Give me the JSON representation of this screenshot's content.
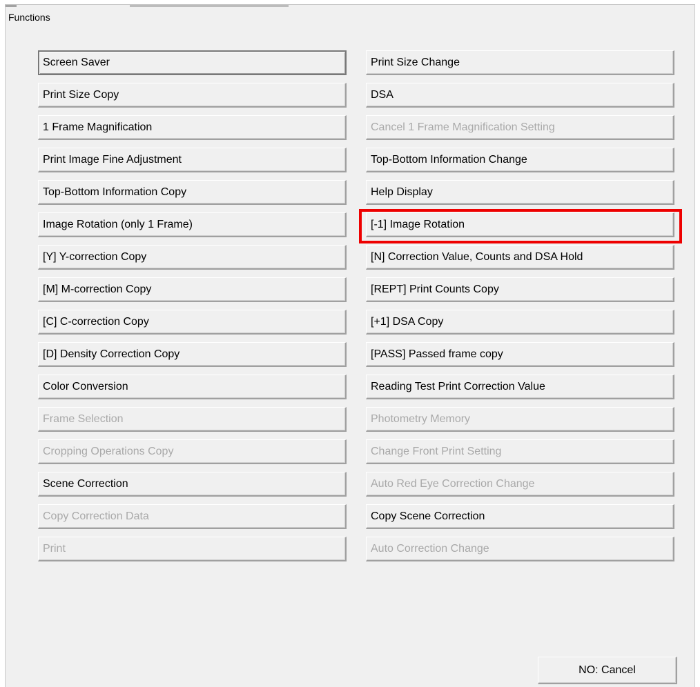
{
  "window": {
    "title": "Functions"
  },
  "functions": {
    "left": [
      {
        "label": "Screen Saver",
        "enabled": true
      },
      {
        "label": "Print Size Copy",
        "enabled": true
      },
      {
        "label": "1 Frame Magnification",
        "enabled": true
      },
      {
        "label": "Print Image Fine Adjustment",
        "enabled": true
      },
      {
        "label": "Top-Bottom Information Copy",
        "enabled": true
      },
      {
        "label": "Image Rotation (only 1 Frame)",
        "enabled": true
      },
      {
        "label": "[Y] Y-correction Copy",
        "enabled": true
      },
      {
        "label": "[M] M-correction Copy",
        "enabled": true
      },
      {
        "label": "[C] C-correction Copy",
        "enabled": true
      },
      {
        "label": "[D] Density Correction Copy",
        "enabled": true
      },
      {
        "label": "Color Conversion",
        "enabled": true
      },
      {
        "label": "Frame Selection",
        "enabled": false
      },
      {
        "label": "Cropping Operations Copy",
        "enabled": false
      },
      {
        "label": "Scene Correction",
        "enabled": true
      },
      {
        "label": "Copy Correction Data",
        "enabled": false
      },
      {
        "label": "Print",
        "enabled": false
      }
    ],
    "right": [
      {
        "label": "Print Size Change",
        "enabled": true
      },
      {
        "label": "DSA",
        "enabled": true
      },
      {
        "label": "Cancel 1 Frame Magnification Setting",
        "enabled": false
      },
      {
        "label": "Top-Bottom Information Change",
        "enabled": true
      },
      {
        "label": "Help Display",
        "enabled": true
      },
      {
        "label": "[-1] Image Rotation",
        "enabled": true
      },
      {
        "label": "[N] Correction Value, Counts and DSA Hold",
        "enabled": true
      },
      {
        "label": "[REPT] Print Counts Copy",
        "enabled": true
      },
      {
        "label": "[+1] DSA Copy",
        "enabled": true
      },
      {
        "label": "[PASS] Passed frame copy",
        "enabled": true
      },
      {
        "label": "Reading Test Print Correction Value",
        "enabled": true
      },
      {
        "label": "Photometry Memory",
        "enabled": false
      },
      {
        "label": "Change Front Print Setting",
        "enabled": false
      },
      {
        "label": "Auto Red Eye Correction Change",
        "enabled": false
      },
      {
        "label": "Copy Scene Correction",
        "enabled": true
      },
      {
        "label": "Auto Correction Change",
        "enabled": false
      }
    ]
  },
  "footer": {
    "cancel_label": "NO: Cancel"
  },
  "colors": {
    "highlight": "#ee0000",
    "disabled_text": "#a9a9a9",
    "background": "#f0f0f0"
  }
}
